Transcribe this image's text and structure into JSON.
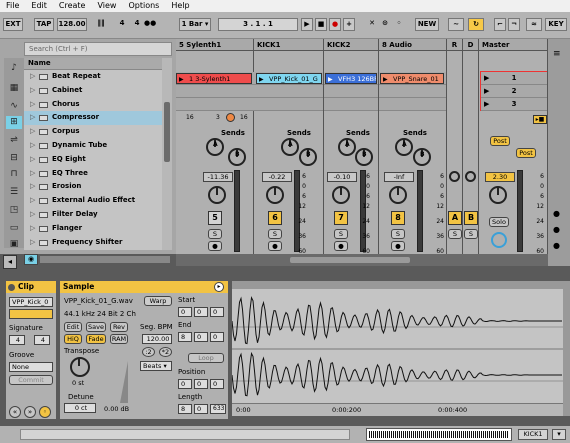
{
  "menu": [
    "File",
    "Edit",
    "Create",
    "View",
    "Options",
    "Help"
  ],
  "transport": {
    "ext": "EXT",
    "tap": "TAP",
    "tempo": "128.00",
    "sig_num": "4",
    "sig_den": "4",
    "quant": "1 Bar ▾",
    "position": "3 .   1 .   1",
    "new": "NEW",
    "key": "KEY"
  },
  "browser": {
    "search_placeholder": "Search (Ctrl + F)",
    "header": "Name",
    "items": [
      "Beat Repeat",
      "Cabinet",
      "Chorus",
      "Compressor",
      "Corpus",
      "Dynamic Tube",
      "EQ Eight",
      "EQ Three",
      "Erosion",
      "External Audio Effect",
      "Filter Delay",
      "Flanger",
      "Frequency Shifter"
    ],
    "selected": 3
  },
  "tracks": [
    {
      "name": "5 Sylenth1",
      "clip": "1 3-Sylenth1",
      "clip_color": "#ef4c4c",
      "num": "",
      "vol": "-11.36",
      "color": "#f2c343"
    },
    {
      "name": "KICK1",
      "clip": "VPP_Kick_01_G",
      "clip_color": "#7fd6f0",
      "num": "6",
      "vol": "-0.22",
      "color": "#f2c343"
    },
    {
      "name": "KICK2",
      "clip": "VFH3 126BP",
      "clip_color": "#3b6fd8",
      "num": "7",
      "vol": "-0.10",
      "color": "#f2c343"
    },
    {
      "name": "8 Audio",
      "clip": "VPP_Snare_01",
      "clip_color": "#ef8c6c",
      "num": "8",
      "vol": "-Inf",
      "color": "#f2c343"
    }
  ],
  "track_first_num": "5",
  "sends_label": "Sends",
  "knob_a": "A",
  "knob_b": "B",
  "return_labels": [
    "R",
    "D"
  ],
  "master": {
    "name": "Master",
    "scenes": [
      "1",
      "2",
      "3"
    ],
    "post": "Post",
    "vol": "2.30",
    "solo": "Solo"
  },
  "scale": [
    "6",
    "0",
    "6",
    "12",
    "24",
    "36",
    "60"
  ],
  "io": {
    "count1": "16",
    "count2": "3",
    "count3": "16"
  },
  "clip_panel": {
    "title": "Clip",
    "name": "VPP_Kick_0",
    "signature_label": "Signature",
    "sig_num": "4",
    "sig_den": "4",
    "groove_label": "Groove",
    "groove": "None",
    "commit": "Commit"
  },
  "sample_panel": {
    "title": "Sample",
    "file": "VPP_Kick_01_G.wav",
    "info": "44.1 kHz 24 Bit 2 Ch",
    "warp": "Warp",
    "edit": "Edit",
    "save": "Save",
    "rev": "Rev",
    "hiq": "HiQ",
    "fade": "Fade",
    "ram": "RAM",
    "transpose_label": "Transpose",
    "transpose": "0 st",
    "detune_label": "Detune",
    "detune": "0 ct",
    "gain": "0.00 dB",
    "seg_bpm_label": "Seg. BPM",
    "seg_bpm": "120.00",
    "half": ":2",
    "double": "*2",
    "warp_mode": "Beats ▾",
    "start_label": "Start",
    "end_label": "End",
    "loop": "Loop",
    "position_label": "Position",
    "length_label": "Length",
    "start": [
      "0",
      "0",
      "0"
    ],
    "end": [
      "8",
      "0",
      "0"
    ],
    "position": [
      "0",
      "0",
      "0"
    ],
    "length": [
      "8",
      "0",
      "633"
    ]
  },
  "timeline": [
    "0:00",
    "0:00:200",
    "0:00:400"
  ],
  "status": {
    "track": "KICK1"
  }
}
